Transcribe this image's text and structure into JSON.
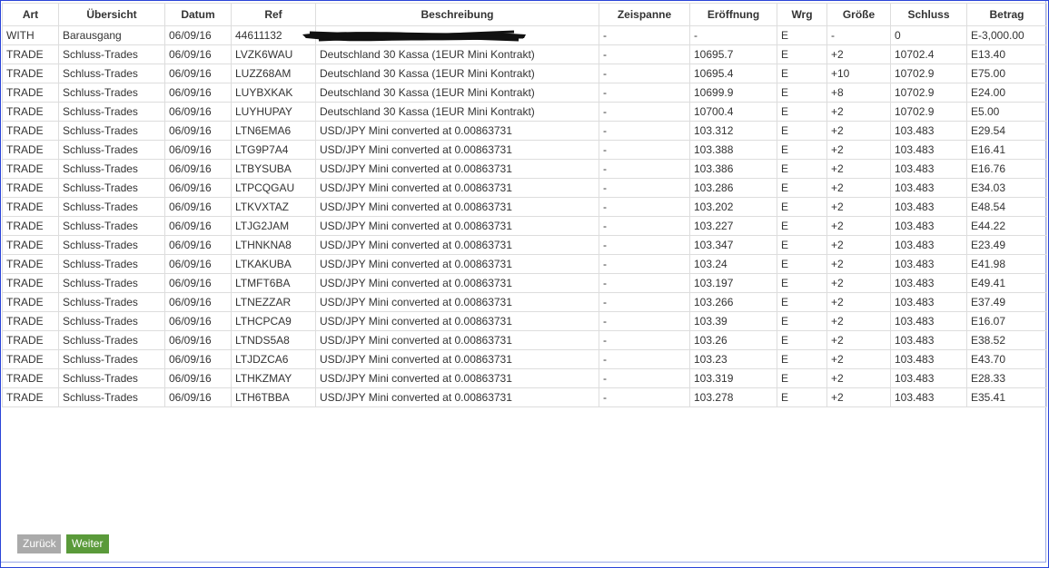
{
  "table": {
    "headers": [
      "Art",
      "Übersicht",
      "Datum",
      "Ref",
      "Beschreibung",
      "Zeispanne",
      "Eröffnung",
      "Wrg",
      "Größe",
      "Schluss",
      "Betrag"
    ],
    "rows": [
      [
        "WITH",
        "Barausgang",
        "06/09/16",
        "44611132",
        "",
        "-",
        "-",
        "E",
        "-",
        "0",
        "E-3,000.00"
      ],
      [
        "TRADE",
        "Schluss-Trades",
        "06/09/16",
        "LVZK6WAU",
        "Deutschland 30 Kassa (1EUR Mini Kontrakt)",
        "-",
        "10695.7",
        "E",
        "+2",
        "10702.4",
        "E13.40"
      ],
      [
        "TRADE",
        "Schluss-Trades",
        "06/09/16",
        "LUZZ68AM",
        "Deutschland 30 Kassa (1EUR Mini Kontrakt)",
        "-",
        "10695.4",
        "E",
        "+10",
        "10702.9",
        "E75.00"
      ],
      [
        "TRADE",
        "Schluss-Trades",
        "06/09/16",
        "LUYBXKAK",
        "Deutschland 30 Kassa (1EUR Mini Kontrakt)",
        "-",
        "10699.9",
        "E",
        "+8",
        "10702.9",
        "E24.00"
      ],
      [
        "TRADE",
        "Schluss-Trades",
        "06/09/16",
        "LUYHUPAY",
        "Deutschland 30 Kassa (1EUR Mini Kontrakt)",
        "-",
        "10700.4",
        "E",
        "+2",
        "10702.9",
        "E5.00"
      ],
      [
        "TRADE",
        "Schluss-Trades",
        "06/09/16",
        "LTN6EMA6",
        "USD/JPY Mini converted at 0.00863731",
        "-",
        "103.312",
        "E",
        "+2",
        "103.483",
        "E29.54"
      ],
      [
        "TRADE",
        "Schluss-Trades",
        "06/09/16",
        "LTG9P7A4",
        "USD/JPY Mini converted at 0.00863731",
        "-",
        "103.388",
        "E",
        "+2",
        "103.483",
        "E16.41"
      ],
      [
        "TRADE",
        "Schluss-Trades",
        "06/09/16",
        "LTBYSUBA",
        "USD/JPY Mini converted at 0.00863731",
        "-",
        "103.386",
        "E",
        "+2",
        "103.483",
        "E16.76"
      ],
      [
        "TRADE",
        "Schluss-Trades",
        "06/09/16",
        "LTPCQGAU",
        "USD/JPY Mini converted at 0.00863731",
        "-",
        "103.286",
        "E",
        "+2",
        "103.483",
        "E34.03"
      ],
      [
        "TRADE",
        "Schluss-Trades",
        "06/09/16",
        "LTKVXTAZ",
        "USD/JPY Mini converted at 0.00863731",
        "-",
        "103.202",
        "E",
        "+2",
        "103.483",
        "E48.54"
      ],
      [
        "TRADE",
        "Schluss-Trades",
        "06/09/16",
        "LTJG2JAM",
        "USD/JPY Mini converted at 0.00863731",
        "-",
        "103.227",
        "E",
        "+2",
        "103.483",
        "E44.22"
      ],
      [
        "TRADE",
        "Schluss-Trades",
        "06/09/16",
        "LTHNKNA8",
        "USD/JPY Mini converted at 0.00863731",
        "-",
        "103.347",
        "E",
        "+2",
        "103.483",
        "E23.49"
      ],
      [
        "TRADE",
        "Schluss-Trades",
        "06/09/16",
        "LTKAKUBA",
        "USD/JPY Mini converted at 0.00863731",
        "-",
        "103.24",
        "E",
        "+2",
        "103.483",
        "E41.98"
      ],
      [
        "TRADE",
        "Schluss-Trades",
        "06/09/16",
        "LTMFT6BA",
        "USD/JPY Mini converted at 0.00863731",
        "-",
        "103.197",
        "E",
        "+2",
        "103.483",
        "E49.41"
      ],
      [
        "TRADE",
        "Schluss-Trades",
        "06/09/16",
        "LTNEZZAR",
        "USD/JPY Mini converted at 0.00863731",
        "-",
        "103.266",
        "E",
        "+2",
        "103.483",
        "E37.49"
      ],
      [
        "TRADE",
        "Schluss-Trades",
        "06/09/16",
        "LTHCPCA9",
        "USD/JPY Mini converted at 0.00863731",
        "-",
        "103.39",
        "E",
        "+2",
        "103.483",
        "E16.07"
      ],
      [
        "TRADE",
        "Schluss-Trades",
        "06/09/16",
        "LTNDS5A8",
        "USD/JPY Mini converted at 0.00863731",
        "-",
        "103.26",
        "E",
        "+2",
        "103.483",
        "E38.52"
      ],
      [
        "TRADE",
        "Schluss-Trades",
        "06/09/16",
        "LTJDZCA6",
        "USD/JPY Mini converted at 0.00863731",
        "-",
        "103.23",
        "E",
        "+2",
        "103.483",
        "E43.70"
      ],
      [
        "TRADE",
        "Schluss-Trades",
        "06/09/16",
        "LTHKZMAY",
        "USD/JPY Mini converted at 0.00863731",
        "-",
        "103.319",
        "E",
        "+2",
        "103.483",
        "E28.33"
      ],
      [
        "TRADE",
        "Schluss-Trades",
        "06/09/16",
        "LTH6TBBA",
        "USD/JPY Mini converted at 0.00863731",
        "-",
        "103.278",
        "E",
        "+2",
        "103.483",
        "E35.41"
      ]
    ]
  },
  "buttons": {
    "back_label": "Zurück",
    "next_label": "Weiter"
  },
  "colors": {
    "frame_border": "#2a44d8",
    "back_button": "#aaaaaa",
    "next_button": "#5a9a3a"
  }
}
